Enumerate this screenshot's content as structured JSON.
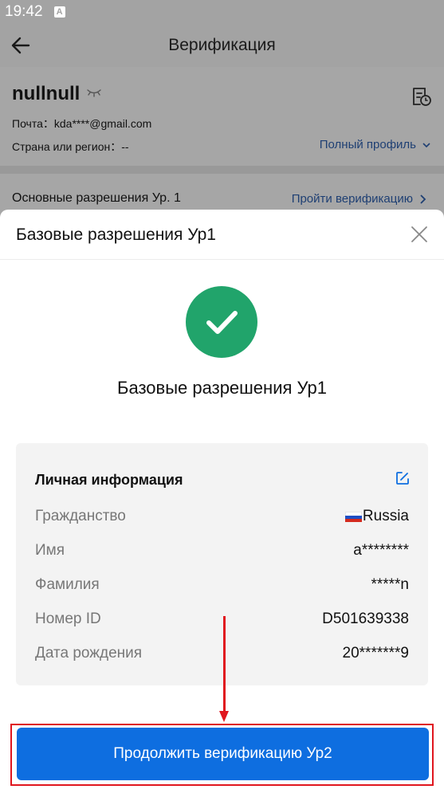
{
  "status_bar": {
    "time": "19:42",
    "notification_glyph": "A"
  },
  "header": {
    "title": "Верификация"
  },
  "profile": {
    "username": "nullnull",
    "email_label": "Почта：",
    "email_value": "kda****@gmail.com",
    "region_label": "Страна или регион：",
    "region_value": "--",
    "full_profile_link": "Полный профиль"
  },
  "permission_row": {
    "label": "Основные разрешения Ур. 1",
    "link": "Пройти верификацию"
  },
  "sheet": {
    "title": "Базовые разрешения Ур1",
    "success_title": "Базовые разрешения Ур1",
    "info_card": {
      "title": "Личная информация",
      "rows": [
        {
          "key": "Гражданство",
          "value": "Russia",
          "flag": "russia-flag"
        },
        {
          "key": "Имя",
          "value": "a********"
        },
        {
          "key": "Фамилия",
          "value": "*****n"
        },
        {
          "key": "Номер ID",
          "value": "D501639338"
        },
        {
          "key": "Дата рождения",
          "value": "20*******9"
        }
      ]
    },
    "cta_label": "Продолжить верификацию Ур2"
  },
  "colors": {
    "accent_blue": "#0e6ee0",
    "success_green": "#21a46b",
    "annotation_red": "#e0161e"
  }
}
